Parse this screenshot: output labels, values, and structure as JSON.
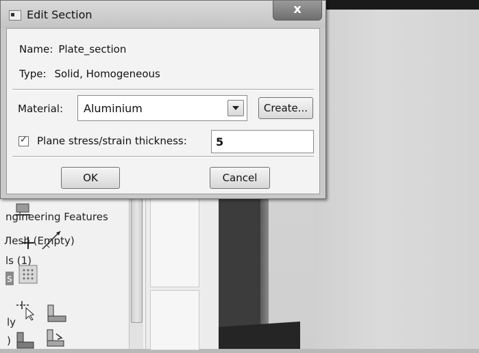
{
  "dialog": {
    "title": "Edit Section",
    "close_glyph": "x",
    "name_label": "Name:",
    "name_value": "Plate_section",
    "type_label": "Type:",
    "type_value": "Solid, Homogeneous",
    "material_label": "Material:",
    "material_value": "Aluminium",
    "create_label": "Create...",
    "thickness_checked": true,
    "thickness_label": "Plane stress/strain thickness:",
    "thickness_value": "5",
    "ok_label": "OK",
    "cancel_label": "Cancel"
  },
  "model_tree": {
    "items": [
      "ngineering Features",
      "Лesh (Empty)",
      "ls (1)",
      "s",
      "ly",
      ")"
    ]
  },
  "toolbox": {
    "icons": [
      "section-tool-icon",
      "create-point-icon",
      "datum-line-icon",
      "grid-icon",
      "partition-icon",
      "face-tool-icon",
      "extrude-icon",
      "revolve-icon"
    ]
  },
  "colors": {
    "dialog_bg": "#f3f3f3",
    "titlebar": "#c9c9c9",
    "viewport": "#d4d4d4",
    "part": "#3a3a3a"
  }
}
